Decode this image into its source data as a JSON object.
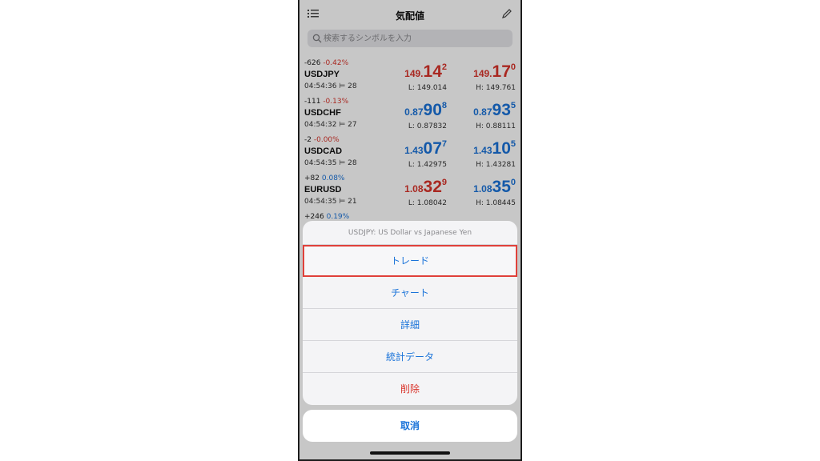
{
  "header": {
    "title": "気配値",
    "menu_icon": "list-icon",
    "edit_icon": "pencil-icon"
  },
  "search": {
    "placeholder": "検索するシンボルを入力",
    "icon": "search-icon"
  },
  "quotes": [
    {
      "change_points": "-626",
      "change_pct": "-0.42%",
      "symbol": "USDJPY",
      "time": "04:54:36",
      "spread": "28",
      "bid": {
        "prefix": "149.",
        "big": "14",
        "sup": "2",
        "color": "red"
      },
      "ask": {
        "prefix": "149.",
        "big": "17",
        "sup": "0",
        "color": "red"
      },
      "low": "L: 149.014",
      "high": "H: 149.761"
    },
    {
      "change_points": "-111",
      "change_pct": "-0.13%",
      "symbol": "USDCHF",
      "time": "04:54:32",
      "spread": "27",
      "bid": {
        "prefix": "0.87",
        "big": "90",
        "sup": "8",
        "color": "blue"
      },
      "ask": {
        "prefix": "0.87",
        "big": "93",
        "sup": "5",
        "color": "blue"
      },
      "low": "L: 0.87832",
      "high": "H: 0.88111"
    },
    {
      "change_points": "-2",
      "change_pct": "-0.00%",
      "symbol": "USDCAD",
      "time": "04:54:35",
      "spread": "28",
      "bid": {
        "prefix": "1.43",
        "big": "07",
        "sup": "7",
        "color": "blue"
      },
      "ask": {
        "prefix": "1.43",
        "big": "10",
        "sup": "5",
        "color": "blue"
      },
      "low": "L: 1.42975",
      "high": "H: 1.43281"
    },
    {
      "change_points": "+82",
      "change_pct": "0.08%",
      "symbol": "EURUSD",
      "time": "04:54:35",
      "spread": "21",
      "bid": {
        "prefix": "1.08",
        "big": "32",
        "sup": "9",
        "color": "red"
      },
      "ask": {
        "prefix": "1.08",
        "big": "35",
        "sup": "0",
        "color": "blue"
      },
      "low": "L: 1.08042",
      "high": "H: 1.08445"
    },
    {
      "change_points": "+246",
      "change_pct": "0.19%"
    }
  ],
  "action_sheet": {
    "title": "USDJPY: US Dollar vs Japanese Yen",
    "items": [
      {
        "label": "トレード",
        "highlighted": true
      },
      {
        "label": "チャート"
      },
      {
        "label": "詳細"
      },
      {
        "label": "統計データ"
      },
      {
        "label": "削除",
        "destructive": true
      }
    ],
    "cancel": "取消"
  },
  "colors": {
    "red": "#d9342b",
    "blue": "#1a73d9",
    "highlight_box": "#e0403a"
  }
}
